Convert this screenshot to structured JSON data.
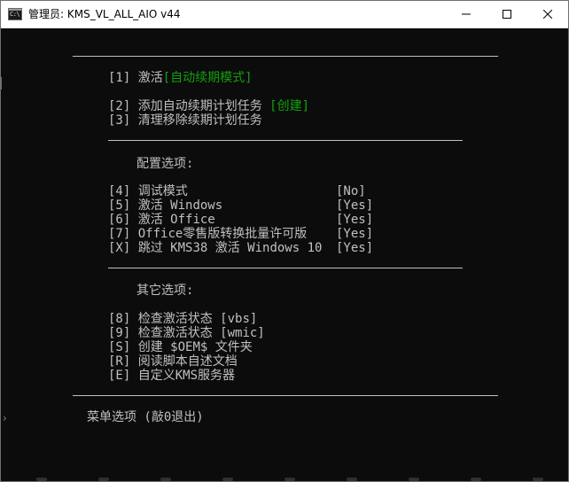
{
  "window": {
    "title": "管理员:  KMS_VL_ALL_AIO v44",
    "icon_glyph": "C:\\"
  },
  "menu": {
    "group1": [
      {
        "key": "[1]",
        "label": "激活",
        "suffix": "[自动续期模式]"
      },
      {
        "key": "[2]",
        "label": "添加自动续期计划任务",
        "suffix": "[创建]"
      },
      {
        "key": "[3]",
        "label": "清理移除续期计划任务",
        "suffix": ""
      }
    ],
    "config_heading": "配置选项:",
    "config": [
      {
        "key": "[4]",
        "label": "调试模式",
        "value": "[No]"
      },
      {
        "key": "[5]",
        "label": "激活 Windows",
        "value": "[Yes]"
      },
      {
        "key": "[6]",
        "label": "激活 Office",
        "value": "[Yes]"
      },
      {
        "key": "[7]",
        "label": "Office零售版转换批量许可版",
        "value": "[Yes]"
      },
      {
        "key": "[X]",
        "label": "跳过 KMS38 激活 Windows 10",
        "value": "[Yes]"
      }
    ],
    "other_heading": "其它选项:",
    "other": [
      {
        "key": "[8]",
        "label": "检查激活状态 [vbs]"
      },
      {
        "key": "[9]",
        "label": "检查激活状态 [wmic]"
      },
      {
        "key": "[S]",
        "label": "创建 $OEM$ 文件夹"
      },
      {
        "key": "[R]",
        "label": "阅读脚本自述文档"
      },
      {
        "key": "[E]",
        "label": "自定义KMS服务器"
      }
    ],
    "prompt": "菜单选项 (敲0退出)"
  },
  "colors": {
    "background": "#0c0c0c",
    "text": "#c0c0c0",
    "accent_green": "#13a10e",
    "titlebar": "#ffffff"
  },
  "icons": [
    "console-app-icon",
    "minimize-icon",
    "maximize-icon",
    "close-icon",
    "chevron-right-icon"
  ]
}
